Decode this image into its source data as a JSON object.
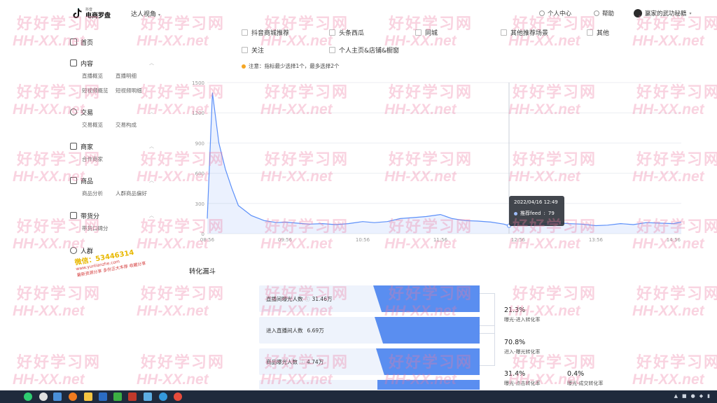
{
  "header": {
    "logo_small": "抖音",
    "logo_main": "电商罗盘",
    "view_switch": "达人视角",
    "personal_center": "个人中心",
    "help": "帮助",
    "username": "赢家的武功秘籍"
  },
  "sidebar": {
    "groups": [
      {
        "label": "首页",
        "subs": []
      },
      {
        "label": "内容",
        "subs": [
          "直播概览",
          "直播明细",
          "短视频概览",
          "短视频明细"
        ]
      },
      {
        "label": "交易",
        "subs": [
          "交易概览",
          "交易构成"
        ]
      },
      {
        "label": "商家",
        "subs": [
          "合作商家"
        ]
      },
      {
        "label": "商品",
        "subs": [
          "商品分析",
          "人群商品偏好"
        ]
      },
      {
        "label": "带货分",
        "subs": [
          "带货口碑分"
        ]
      },
      {
        "label": "人群",
        "subs": []
      }
    ]
  },
  "filters": {
    "options": [
      "抖音商城推荐",
      "头条西瓜",
      "同城",
      "其他推荐场景",
      "其他",
      "关注",
      "个人主页&店铺&橱窗"
    ],
    "notice": "注意：指标最少选择1个，最多选择2个"
  },
  "chart_data": {
    "type": "area",
    "series": [
      {
        "name": "推荐feed",
        "color": "#5b8ff9"
      }
    ],
    "x": [
      "08:56",
      "09:00",
      "09:05",
      "09:10",
      "09:15",
      "09:20",
      "09:30",
      "09:40",
      "09:50",
      "09:56",
      "10:05",
      "10:15",
      "10:25",
      "10:35",
      "10:45",
      "10:56",
      "11:05",
      "11:15",
      "11:25",
      "11:35",
      "11:45",
      "11:56",
      "12:05",
      "12:15",
      "12:25",
      "12:35",
      "12:45",
      "12:49",
      "12:56",
      "13:05",
      "13:15",
      "13:25",
      "13:35",
      "13:45",
      "13:56",
      "14:05",
      "14:15",
      "14:25",
      "14:35",
      "14:45",
      "14:56",
      "15:02"
    ],
    "y": [
      150,
      1400,
      900,
      640,
      450,
      280,
      180,
      130,
      110,
      115,
      105,
      95,
      100,
      90,
      100,
      120,
      110,
      120,
      150,
      160,
      170,
      190,
      150,
      130,
      125,
      115,
      95,
      79,
      100,
      85,
      95,
      110,
      100,
      95,
      80,
      85,
      100,
      90,
      110,
      105,
      100,
      115
    ],
    "ylim": [
      0,
      1500
    ],
    "yticks": [
      0,
      300,
      600,
      900,
      1200,
      1500
    ],
    "xticks": [
      "08:56",
      "09:56",
      "10:56",
      "11:56",
      "12:56",
      "13:56",
      "14:56"
    ],
    "grid": true,
    "tooltip": {
      "time": "2022/04/16 12:49",
      "series": "推荐feed",
      "value": 79
    }
  },
  "funnel": {
    "title": "转化漏斗",
    "stages": [
      {
        "label": "直播间曝光人数",
        "value": "31.46万"
      },
      {
        "label": "进入直播间人数",
        "value": "6.69万"
      },
      {
        "label": "商品曝光人数",
        "value": "4.74万"
      },
      {
        "label": "",
        "value": ""
      }
    ],
    "rates": [
      {
        "value": "21.3%",
        "label": "曝光-进入转化率"
      },
      {
        "value": "70.8%",
        "label": "进入-曝光转化率"
      },
      {
        "value": "31.4%",
        "label": "曝光-点击转化率"
      },
      {
        "value": "0.4%",
        "label": "曝光-成交转化率"
      }
    ]
  },
  "watermark": {
    "cn": "好好学习网",
    "en": "HH-XX.net"
  },
  "promo": {
    "line1": "微信：53446314",
    "line2": "www.yunlianzhe.com",
    "line3": "最新资源分享 多份正大丰厚 收藏分享"
  },
  "colors": {
    "accent": "#5a8ef0",
    "line": "#5b8ff9",
    "taskbar": "#1f2a3c"
  }
}
